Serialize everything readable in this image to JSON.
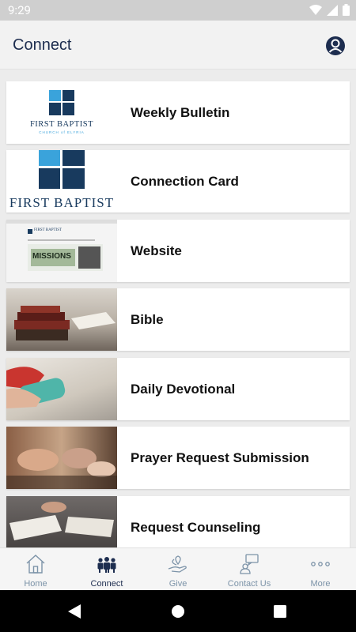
{
  "status_bar": {
    "time": "9:29"
  },
  "app_bar": {
    "title": "Connect"
  },
  "items": [
    {
      "label": "Weekly Bulletin",
      "logo_text": "FIRST BAPTIST",
      "logo_subtext": "CHURCH of ELYRIA"
    },
    {
      "label": "Connection Card",
      "logo_text": "FIRST BAPTIST"
    },
    {
      "label": "Website",
      "site_title": "FIRST BAPTIST",
      "banner_text": "MISSIONS"
    },
    {
      "label": "Bible"
    },
    {
      "label": "Daily Devotional"
    },
    {
      "label": "Prayer Request Submission"
    },
    {
      "label": "Request Counseling"
    }
  ],
  "nav": [
    {
      "label": "Home",
      "icon": "home-icon",
      "active": false
    },
    {
      "label": "Connect",
      "icon": "people-icon",
      "active": true
    },
    {
      "label": "Give",
      "icon": "giving-hand-icon",
      "active": false
    },
    {
      "label": "Contact Us",
      "icon": "contact-chat-icon",
      "active": false
    },
    {
      "label": "More",
      "icon": "more-dots-icon",
      "active": false
    }
  ],
  "colors": {
    "accent": "#1d2d4f",
    "nav_inactive": "#7c93a8",
    "logo_blue": "#3aa3db",
    "logo_navy": "#183a5e"
  }
}
